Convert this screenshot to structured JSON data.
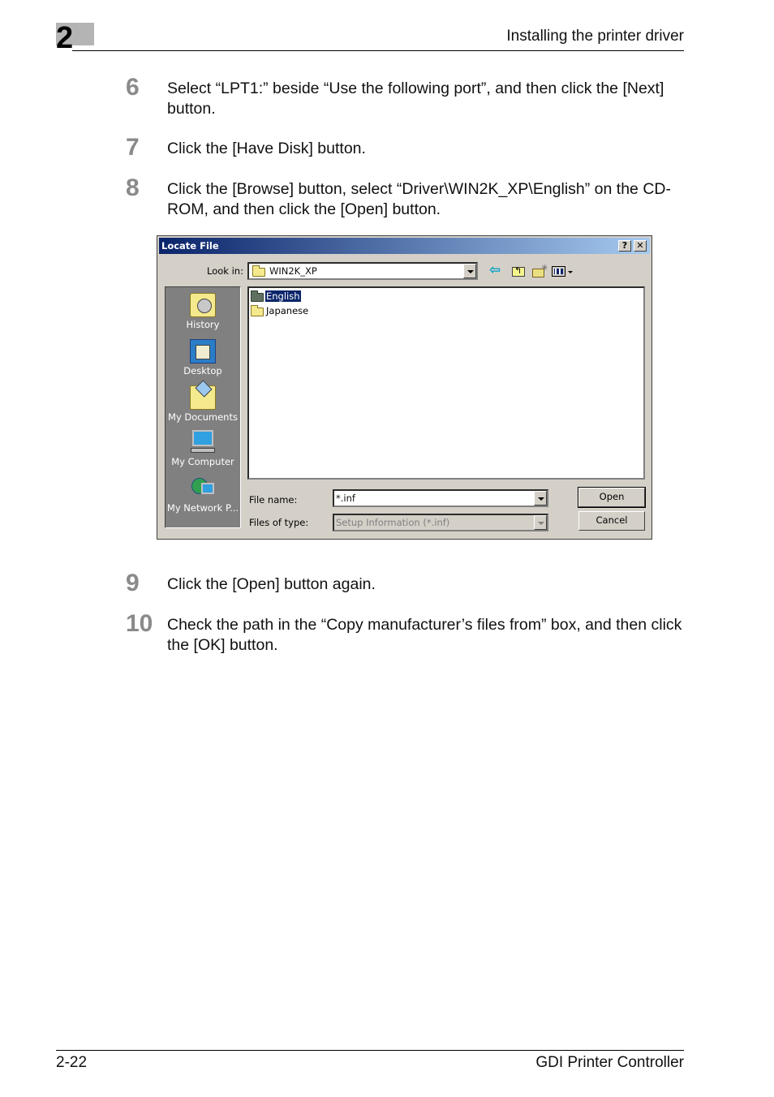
{
  "header": {
    "chapter_number": "2",
    "section_title": "Installing the printer driver"
  },
  "steps": [
    {
      "number": "6",
      "text": "Select “LPT1:” beside “Use the following port”, and then click the [Next] button."
    },
    {
      "number": "7",
      "text": "Click the [Have Disk] button."
    },
    {
      "number": "8",
      "text": "Click the [Browse] button, select “Driver\\WIN2K_XP\\English” on the CD-ROM, and then click the [Open] button."
    },
    {
      "number": "9",
      "text": "Click the [Open] button again."
    },
    {
      "number": "10",
      "text": "Check the path in the “Copy manufacturer’s files from” box, and then click the [OK] button."
    }
  ],
  "dialog": {
    "title": "Locate File",
    "help_button": "?",
    "close_button": "✕",
    "look_in_label": "Look in:",
    "look_in_value": "WIN2K_XP",
    "toolbar_icons": [
      "back-icon",
      "up-folder-icon",
      "new-folder-icon",
      "views-menu-icon"
    ],
    "places": [
      {
        "label": "History",
        "icon": "history-icon"
      },
      {
        "label": "Desktop",
        "icon": "desktop-icon"
      },
      {
        "label": "My Documents",
        "icon": "my-documents-icon"
      },
      {
        "label": "My Computer",
        "icon": "my-computer-icon"
      },
      {
        "label": "My Network P...",
        "icon": "my-network-places-icon"
      }
    ],
    "files": [
      {
        "name": "English",
        "selected": true
      },
      {
        "name": "Japanese",
        "selected": false
      }
    ],
    "file_name_label": "File name:",
    "file_name_value": "*.inf",
    "files_of_type_label": "Files of type:",
    "files_of_type_value": "Setup Information (*.inf)",
    "open_button": "Open",
    "cancel_button": "Cancel"
  },
  "footer": {
    "page_number": "2-22",
    "product_name": "GDI Printer Controller"
  }
}
